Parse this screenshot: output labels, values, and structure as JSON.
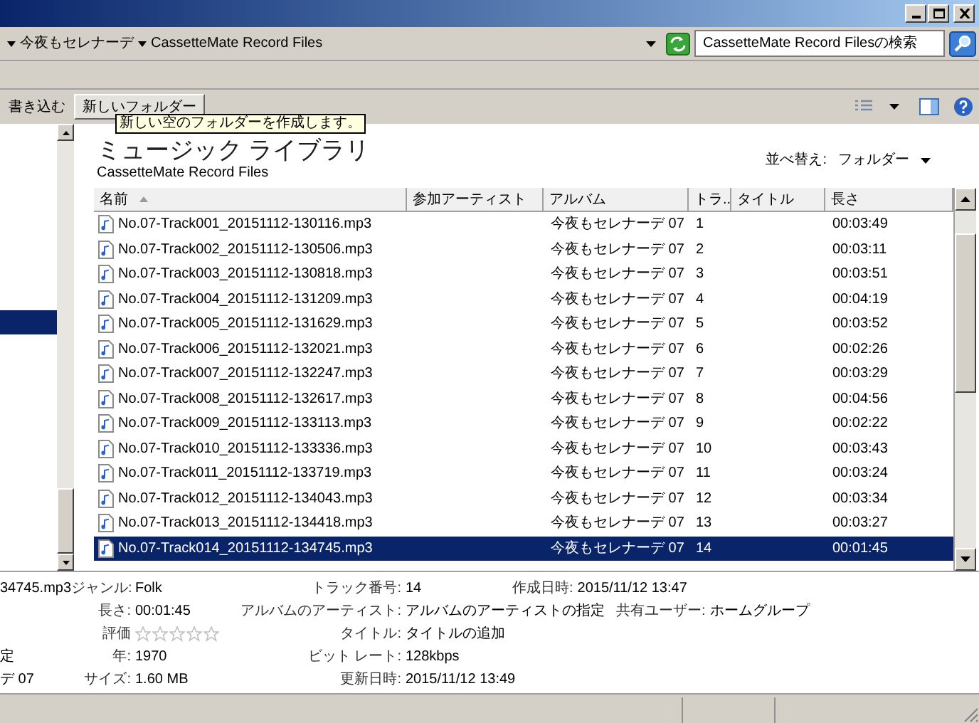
{
  "address_bar": {
    "breadcrumb": [
      "今夜もセレナーデ",
      "CassetteMate Record Files"
    ]
  },
  "search": {
    "placeholder": "CassetteMate Record Filesの検索"
  },
  "toolbar": {
    "buttons": [
      {
        "label": "書き込む",
        "kind": "flat"
      },
      {
        "label": "新しいフォルダー",
        "kind": "raised"
      }
    ],
    "tooltip": "新しい空のフォルダーを作成します。"
  },
  "navigation_pane": {
    "items": [
      {
        "selected": true
      }
    ]
  },
  "library": {
    "title": "ミュージック ライブラリ",
    "subtitle": "CassetteMate Record Files",
    "sort_label": "並べ替え:",
    "sort_value": "フォルダー"
  },
  "table": {
    "columns": [
      {
        "label": "名前",
        "sorted": true
      },
      {
        "label": "参加アーティスト"
      },
      {
        "label": "アルバム"
      },
      {
        "label": "トラ.."
      },
      {
        "label": "タイトル"
      },
      {
        "label": "長さ"
      }
    ],
    "rows": [
      {
        "name": "No.07-Track001_20151112-130116.mp3",
        "album": "今夜もセレナーデ 07",
        "track": "1",
        "length": "00:03:49",
        "selected": false
      },
      {
        "name": "No.07-Track002_20151112-130506.mp3",
        "album": "今夜もセレナーデ 07",
        "track": "2",
        "length": "00:03:11",
        "selected": false
      },
      {
        "name": "No.07-Track003_20151112-130818.mp3",
        "album": "今夜もセレナーデ 07",
        "track": "3",
        "length": "00:03:51",
        "selected": false
      },
      {
        "name": "No.07-Track004_20151112-131209.mp3",
        "album": "今夜もセレナーデ 07",
        "track": "4",
        "length": "00:04:19",
        "selected": false
      },
      {
        "name": "No.07-Track005_20151112-131629.mp3",
        "album": "今夜もセレナーデ 07",
        "track": "5",
        "length": "00:03:52",
        "selected": false
      },
      {
        "name": "No.07-Track006_20151112-132021.mp3",
        "album": "今夜もセレナーデ 07",
        "track": "6",
        "length": "00:02:26",
        "selected": false
      },
      {
        "name": "No.07-Track007_20151112-132247.mp3",
        "album": "今夜もセレナーデ 07",
        "track": "7",
        "length": "00:03:29",
        "selected": false
      },
      {
        "name": "No.07-Track008_20151112-132617.mp3",
        "album": "今夜もセレナーデ 07",
        "track": "8",
        "length": "00:04:56",
        "selected": false
      },
      {
        "name": "No.07-Track009_20151112-133113.mp3",
        "album": "今夜もセレナーデ 07",
        "track": "9",
        "length": "00:02:22",
        "selected": false
      },
      {
        "name": "No.07-Track010_20151112-133336.mp3",
        "album": "今夜もセレナーデ 07",
        "track": "10",
        "length": "00:03:43",
        "selected": false
      },
      {
        "name": "No.07-Track011_20151112-133719.mp3",
        "album": "今夜もセレナーデ 07",
        "track": "11",
        "length": "00:03:24",
        "selected": false
      },
      {
        "name": "No.07-Track012_20151112-134043.mp3",
        "album": "今夜もセレナーデ 07",
        "track": "12",
        "length": "00:03:34",
        "selected": false
      },
      {
        "name": "No.07-Track013_20151112-134418.mp3",
        "album": "今夜もセレナーデ 07",
        "track": "13",
        "length": "00:03:27",
        "selected": false
      },
      {
        "name": "No.07-Track014_20151112-134745.mp3",
        "album": "今夜もセレナーデ 07",
        "track": "14",
        "length": "00:01:45",
        "selected": true
      }
    ]
  },
  "details": {
    "rows": [
      {
        "left": "34745.mp3",
        "items": [
          {
            "label": "ジャンル:",
            "value": "Folk"
          },
          {
            "label": "トラック番号:",
            "value": "14"
          },
          {
            "label": "作成日時:",
            "value": "2015/11/12 13:47"
          }
        ]
      },
      {
        "items": [
          {
            "label": "長さ:",
            "value": "00:01:45"
          },
          {
            "label": "アルバムのアーティスト:",
            "value": "アルバムのアーティストの指定"
          },
          {
            "label": "共有ユーザー:",
            "value": "ホームグループ"
          }
        ]
      },
      {
        "items": [
          {
            "label": "評価",
            "kind": "rating",
            "stars": 0
          },
          {
            "label": "タイトル:",
            "value": "タイトルの追加"
          }
        ]
      },
      {
        "left": "定",
        "items": [
          {
            "label": "年:",
            "value": "1970"
          },
          {
            "label": "ビット レート:",
            "value": "128kbps"
          }
        ]
      },
      {
        "left": "デ 07",
        "items": [
          {
            "label": "サイズ:",
            "value": "1.60 MB"
          },
          {
            "label": "更新日時:",
            "value": "2015/11/12 13:49"
          }
        ]
      }
    ]
  }
}
